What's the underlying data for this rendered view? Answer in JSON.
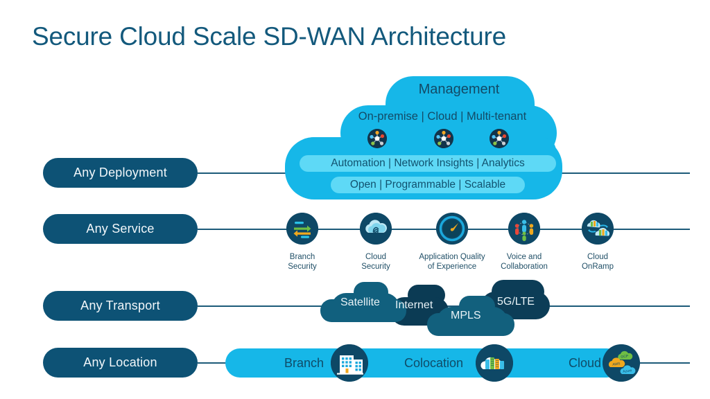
{
  "page": {
    "title": "Secure Cloud Scale SD-WAN Architecture",
    "background": "#ffffff",
    "title_color": "#13597C"
  },
  "colors": {
    "pill_navy": "#0D5275",
    "line": "#1C5A79",
    "cloud_cyan": "#16B7E8",
    "cloud_pill_cyan": "#5ED9F6",
    "icon_navy": "#0E4866",
    "transport_teal": "#11607E",
    "transport_dark": "#0B3B54",
    "label_blue": "#11526F"
  },
  "rows": [
    {
      "label": "Any Deployment"
    },
    {
      "label": "Any Service"
    },
    {
      "label": "Any Transport"
    },
    {
      "label": "Any Location"
    }
  ],
  "management_cloud": {
    "title": "Management",
    "subtitle": "On-premise | Cloud | Multi-tenant",
    "pill_top": "Automation | Network Insights | Analytics",
    "pill_bottom": "Open | Programmable | Scalable",
    "node_icons": [
      "network-node-icon",
      "network-node-icon",
      "network-node-icon"
    ]
  },
  "services": [
    {
      "icon": "branch-security-icon",
      "line1": "Branch",
      "line2": "Security"
    },
    {
      "icon": "cloud-security-icon",
      "line1": "Cloud",
      "line2": "Security"
    },
    {
      "icon": "app-quality-icon",
      "line1": "Application Quality",
      "line2": "of Experience"
    },
    {
      "icon": "voice-collab-icon",
      "line1": "Voice and",
      "line2": "Collaboration"
    },
    {
      "icon": "cloud-onramp-icon",
      "line1": "Cloud",
      "line2": "OnRamp"
    }
  ],
  "transports": [
    {
      "label": "Satellite",
      "color": "#11607E"
    },
    {
      "label": "Internet",
      "color": "#0B3B54"
    },
    {
      "label": "MPLS",
      "color": "#12607D"
    },
    {
      "label": "5G/LTE",
      "color": "#0C3D57"
    }
  ],
  "locations": [
    {
      "label": "Branch",
      "icon": "office-building-icon"
    },
    {
      "label": "Colocation",
      "icon": "datacenter-cloud-icon"
    },
    {
      "label": "Cloud",
      "icon": "public-cloud-icon",
      "providers": [
        "GCP",
        "AWS",
        "Azure"
      ]
    }
  ]
}
